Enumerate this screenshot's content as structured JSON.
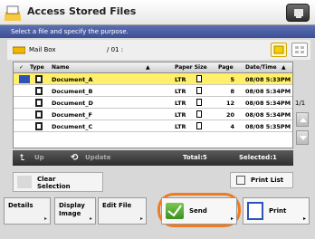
{
  "header": {
    "title": "Access Stored Files"
  },
  "instruction": "Select a file and specify the purpose.",
  "mailbox": {
    "label": "Mail Box",
    "page_info": "/ 01 :"
  },
  "table": {
    "columns": {
      "check": "✓",
      "type": "Type",
      "name": "Name",
      "paper_size": "Paper Size",
      "page": "Page",
      "datetime": "Date/Time"
    },
    "rows": [
      {
        "name": "Document_A",
        "size": "LTR",
        "page": "5",
        "date": "08/08 5:33PM",
        "selected": true
      },
      {
        "name": "Document_B",
        "size": "LTR",
        "page": "8",
        "date": "08/08 5:34PM",
        "selected": false
      },
      {
        "name": "Document_D",
        "size": "LTR",
        "page": "12",
        "date": "08/08 5:34PM",
        "selected": false
      },
      {
        "name": "Document_F",
        "size": "LTR",
        "page": "20",
        "date": "08/08 5:34PM",
        "selected": false
      },
      {
        "name": "Document_C",
        "size": "LTR",
        "page": "4",
        "date": "08/08 5:35PM",
        "selected": false
      }
    ]
  },
  "pager": "1/1",
  "strip": {
    "up_label": "Up",
    "update_label": "Update",
    "total": "Total:5",
    "selected": "Selected:1"
  },
  "buttons": {
    "clear_selection": "Clear Selection",
    "print_list": "Print List",
    "details": "Details",
    "display_image": "Display Image",
    "edit_file": "Edit File",
    "send": "Send",
    "print": "Print"
  },
  "colors": {
    "accent_orange": "#f07a1f",
    "selected_row": "#ffef6a",
    "instruction_bar": "#4a5da5"
  }
}
